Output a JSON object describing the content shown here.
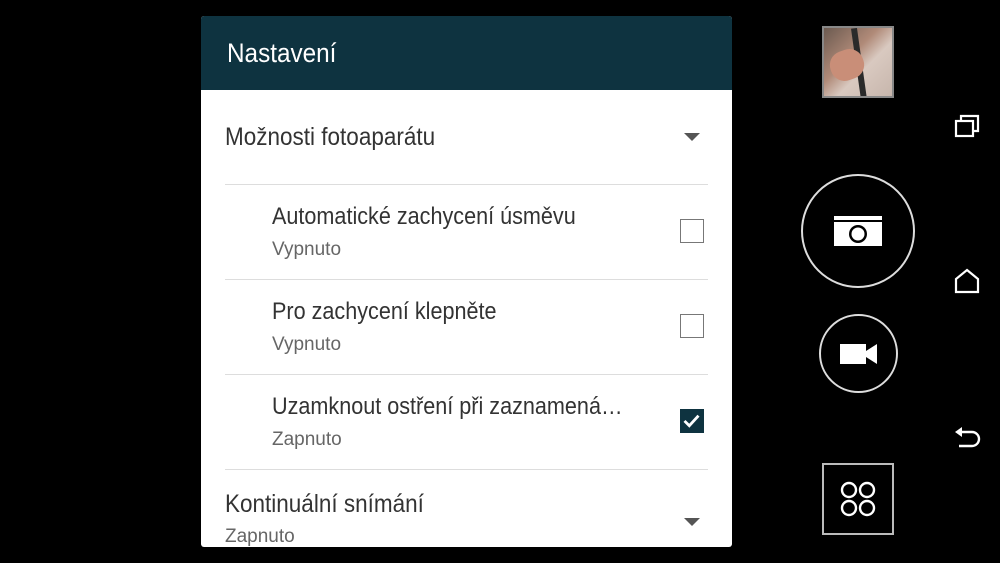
{
  "dialog": {
    "title": "Nastavení",
    "sections": [
      {
        "title": "Možnosti fotoaparátu",
        "expanded": true,
        "items": [
          {
            "title": "Automatické zachycení úsměvu",
            "subtitle": "Vypnuto",
            "checked": false
          },
          {
            "title": "Pro zachycení klepněte",
            "subtitle": "Vypnuto",
            "checked": false
          },
          {
            "title": "Uzamknout ostření při zaznamená…",
            "subtitle": "Zapnuto",
            "checked": true
          }
        ]
      },
      {
        "title": "Kontinuální snímání",
        "subtitle": "Zapnuto",
        "expanded": false
      }
    ]
  },
  "camera_controls": {
    "gallery_thumbnail_icon": "gallery-thumbnail",
    "shutter_icon": "camera-icon",
    "video_icon": "video-camera-icon",
    "apps_icon": "grid-dots-icon"
  },
  "nav_bar": {
    "recents_icon": "recents-icon",
    "home_icon": "home-icon",
    "back_icon": "back-icon"
  },
  "colors": {
    "header_bg": "#0e3340",
    "background": "#000000",
    "dialog_bg": "#ffffff"
  }
}
